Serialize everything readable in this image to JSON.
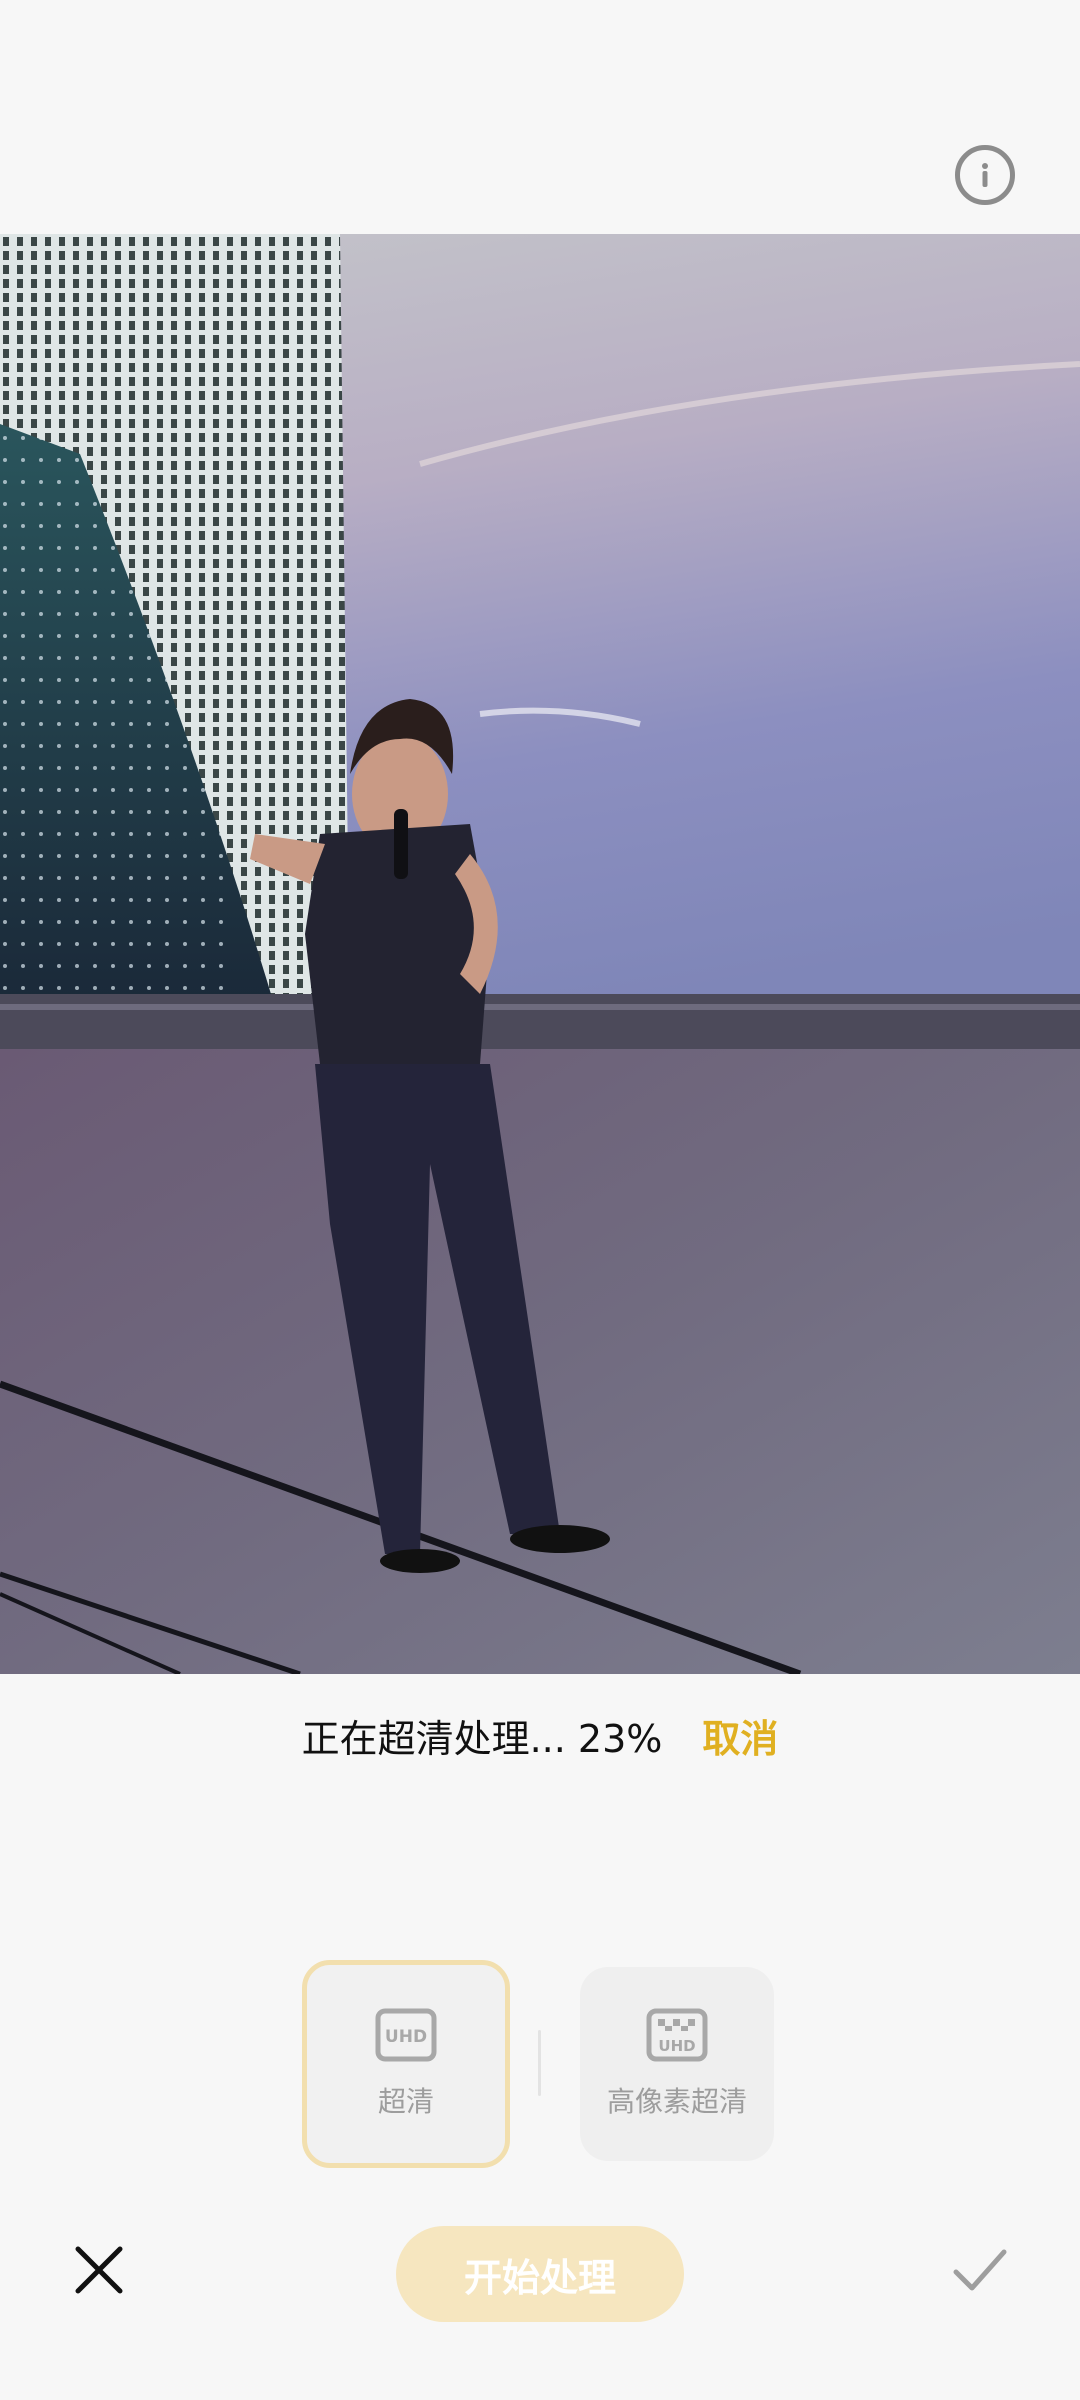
{
  "header": {
    "info_icon": "info-icon"
  },
  "progress": {
    "text": "正在超清处理... 23%",
    "percent": 23,
    "cancel_label": "取消",
    "cancel_color": "#e0b021"
  },
  "modes": [
    {
      "label": "超清",
      "icon": "uhd-icon",
      "icon_text": "UHD",
      "selected": true
    },
    {
      "label": "高像素超清",
      "icon": "uhd-grid-icon",
      "icon_text": "UHD",
      "selected": false
    }
  ],
  "bottom_bar": {
    "close_icon": "close-icon",
    "start_label": "开始处理",
    "confirm_icon": "check-icon"
  },
  "colors": {
    "accent": "#e0b021",
    "selected_border": "#f2dfae",
    "start_button_bg": "#f6e6bf"
  }
}
